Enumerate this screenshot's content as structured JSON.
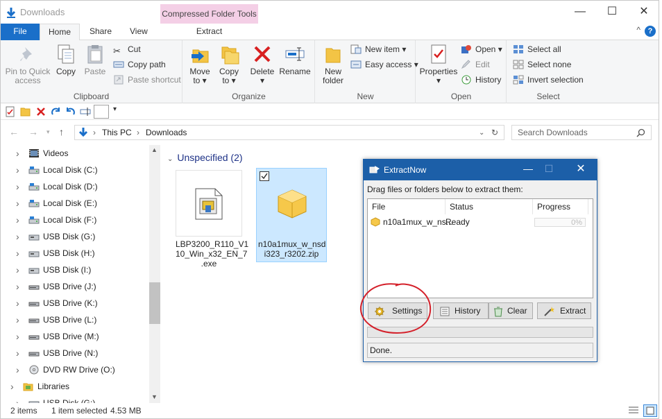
{
  "window": {
    "title": "Downloads",
    "context_header": "Compressed Folder Tools",
    "buttons": {
      "minimize": "—",
      "maximize": "☐",
      "close": "✕"
    }
  },
  "ribbon_tabs": {
    "file": "File",
    "home": "Home",
    "share": "Share",
    "view": "View",
    "extract": "Extract"
  },
  "ribbon": {
    "clipboard": {
      "label": "Clipboard",
      "pin_line1": "Pin to Quick",
      "pin_line2": "access",
      "copy": "Copy",
      "paste": "Paste",
      "cut": "Cut",
      "copy_path": "Copy path",
      "paste_shortcut": "Paste shortcut"
    },
    "organize": {
      "label": "Organize",
      "move_to_line1": "Move",
      "move_to_line2": "to",
      "copy_to_line1": "Copy",
      "copy_to_line2": "to",
      "delete": "Delete",
      "rename": "Rename"
    },
    "new": {
      "label": "New",
      "new_folder_line1": "New",
      "new_folder_line2": "folder",
      "new_item": "New item",
      "easy_access": "Easy access"
    },
    "open": {
      "label": "Open",
      "properties": "Properties",
      "open": "Open",
      "edit": "Edit",
      "history": "History"
    },
    "select": {
      "label": "Select",
      "select_all": "Select all",
      "select_none": "Select none",
      "invert": "Invert selection"
    }
  },
  "address": {
    "crumb1": "This PC",
    "crumb2": "Downloads",
    "search_placeholder": "Search Downloads"
  },
  "tree": [
    {
      "label": "Videos"
    },
    {
      "label": "Local Disk (C:)"
    },
    {
      "label": "Local Disk  (D:)"
    },
    {
      "label": "Local Disk  (E:)"
    },
    {
      "label": "Local Disk  (F:)"
    },
    {
      "label": "USB Disk (G:)"
    },
    {
      "label": "USB Disk (H:)"
    },
    {
      "label": "USB Disk (I:)"
    },
    {
      "label": "USB Drive (J:)"
    },
    {
      "label": "USB Drive (K:)"
    },
    {
      "label": "USB Drive (L:)"
    },
    {
      "label": "USB Drive (M:)"
    },
    {
      "label": "USB Drive (N:)"
    },
    {
      "label": "DVD RW Drive (O:)"
    },
    {
      "label": "Libraries"
    },
    {
      "label": "USB Disk (G:)"
    }
  ],
  "content": {
    "group_heading": "Unspecified (2)",
    "files": [
      {
        "name_line1": "LBP3200_R110_V1",
        "name_line2": "10_Win_x32_EN_7",
        "name_line3": ".exe"
      },
      {
        "name_line1": "n10a1mux_w_nsd",
        "name_line2": "i323_r3202.zip"
      }
    ]
  },
  "status": {
    "items": "2 items",
    "selected": "1 item selected",
    "size": "4.53 MB"
  },
  "extractnow": {
    "title": "ExtractNow",
    "hint": "Drag files or folders below to extract them:",
    "columns": {
      "file": "File",
      "status": "Status",
      "progress": "Progress"
    },
    "row": {
      "file": "n10a1mux_w_ns...",
      "status": "Ready",
      "progress": "0%"
    },
    "buttons": {
      "settings": "Settings",
      "history": "History",
      "clear": "Clear",
      "extract": "Extract"
    },
    "status_text": "Done."
  },
  "colors": {
    "accent": "#1a6fc9",
    "context_tab": "#f4cfe6",
    "dialog_title": "#1c5fa8",
    "annotation": "#d4202a"
  }
}
